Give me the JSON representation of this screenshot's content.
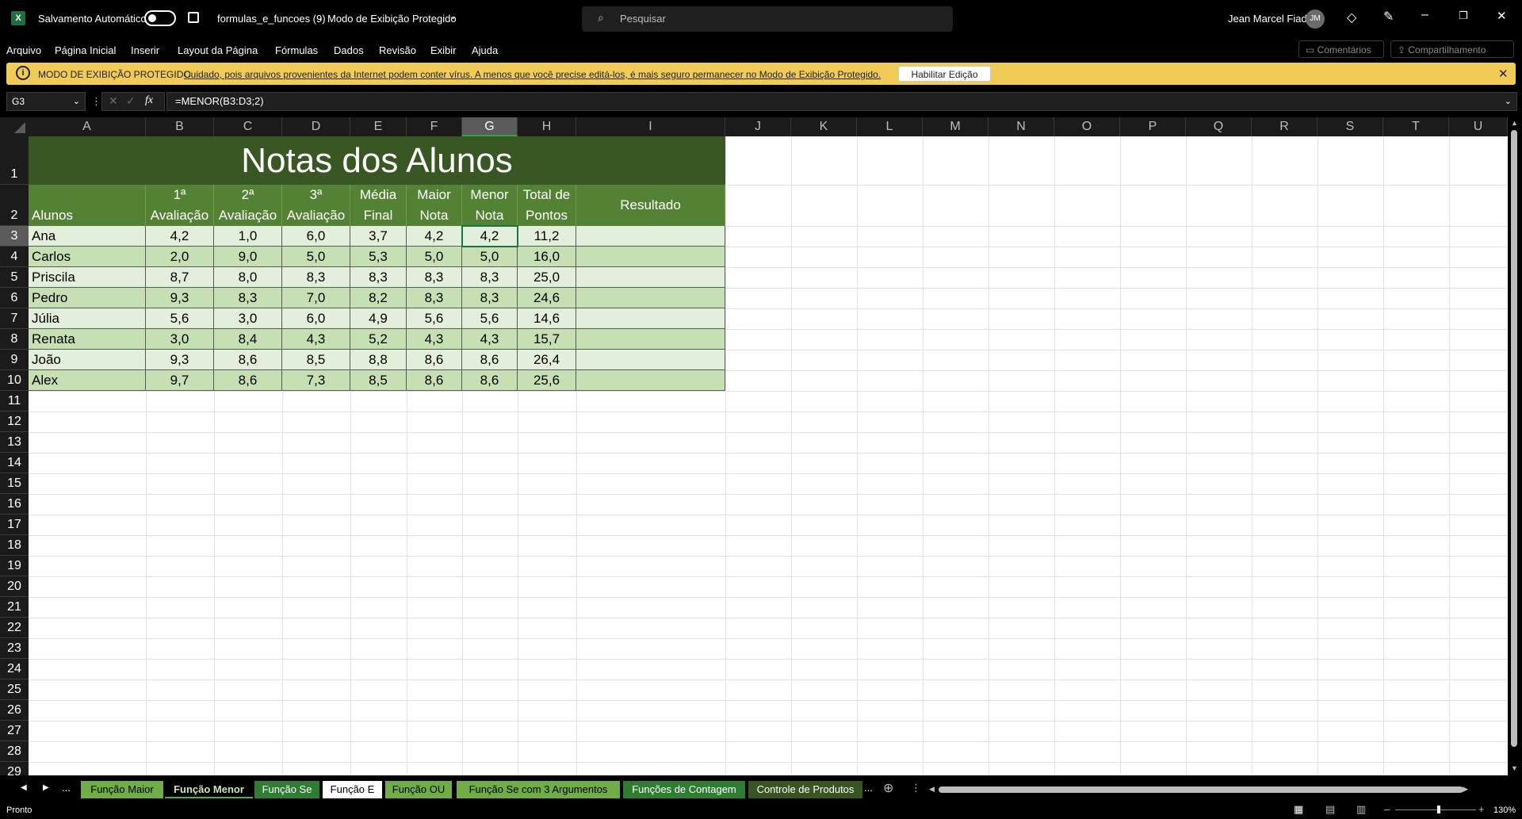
{
  "titlebar": {
    "autosave_label": "Salvamento Automático",
    "filename": "formulas_e_funcoes (9)",
    "separator": "-",
    "mode": "Modo de Exibição Protegido",
    "search_placeholder": "Pesquisar",
    "user_name": "Jean Marcel Fiad",
    "user_initials": "JM"
  },
  "menu": {
    "items": [
      "Arquivo",
      "Página Inicial",
      "Inserir",
      "Layout da Página",
      "Fórmulas",
      "Dados",
      "Revisão",
      "Exibir",
      "Ajuda"
    ],
    "comments": "Comentários",
    "share": "Compartilhamento"
  },
  "banner": {
    "title": "MODO DE EXIBIÇÃO PROTEGIDO",
    "message": "Cuidado, pois arquivos provenientes da Internet podem conter vírus. A menos que você precise editá-los, é mais seguro permanecer no Modo de  Exibição Protegido.",
    "button": "Habilitar Edição",
    "close": "✕"
  },
  "formula": {
    "cell_ref": "G3",
    "fx": "fx",
    "content": "=MENOR(B3:D3;2)"
  },
  "columns": [
    "A",
    "B",
    "C",
    "D",
    "E",
    "F",
    "G",
    "H",
    "I",
    "J",
    "K",
    "L",
    "M",
    "N",
    "O",
    "P",
    "Q",
    "R",
    "S",
    "T",
    "U"
  ],
  "selected_column": "G",
  "rows": [
    "1",
    "2",
    "3",
    "4",
    "5",
    "6",
    "7",
    "8",
    "9",
    "10",
    "11",
    "12",
    "13",
    "14",
    "15",
    "16",
    "17",
    "18",
    "19",
    "20",
    "21",
    "22",
    "23",
    "24",
    "25",
    "26",
    "27",
    "28",
    "29"
  ],
  "selected_row": "3",
  "sheet": {
    "title": "Notas dos Alunos",
    "headers": {
      "alunos": "Alunos",
      "b": [
        "1ª",
        "Avaliação"
      ],
      "c": [
        "2ª",
        "Avaliação"
      ],
      "d": [
        "3ª",
        "Avaliação"
      ],
      "e": [
        "Média",
        "Final"
      ],
      "f": [
        "Maior",
        "Nota"
      ],
      "g": [
        "Menor",
        "Nota"
      ],
      "h": [
        "Total de",
        "Pontos"
      ],
      "i": "Resultado"
    },
    "data": [
      [
        "Ana",
        "4,2",
        "1,0",
        "6,0",
        "3,7",
        "4,2",
        "4,2",
        "11,2",
        ""
      ],
      [
        "Carlos",
        "2,0",
        "9,0",
        "5,0",
        "5,3",
        "5,0",
        "5,0",
        "16,0",
        ""
      ],
      [
        "Priscila",
        "8,7",
        "8,0",
        "8,3",
        "8,3",
        "8,3",
        "8,3",
        "25,0",
        ""
      ],
      [
        "Pedro",
        "9,3",
        "8,3",
        "7,0",
        "8,2",
        "8,3",
        "8,3",
        "24,6",
        ""
      ],
      [
        "Júlia",
        "5,6",
        "3,0",
        "6,0",
        "4,9",
        "5,6",
        "5,6",
        "14,6",
        ""
      ],
      [
        "Renata",
        "3,0",
        "8,4",
        "4,3",
        "5,2",
        "4,3",
        "4,3",
        "15,7",
        ""
      ],
      [
        "João",
        "9,3",
        "8,6",
        "8,5",
        "8,8",
        "8,6",
        "8,6",
        "26,4",
        ""
      ],
      [
        "Alex",
        "9,7",
        "8,6",
        "7,3",
        "8,5",
        "8,6",
        "8,6",
        "25,6",
        ""
      ]
    ]
  },
  "tabs": {
    "ellipsis": "...",
    "items": [
      "Função Maior",
      "Função Menor",
      "Função Se",
      "Função E",
      "Função OU",
      "Função Se com 3 Argumentos",
      "Funções de Contagem",
      "Controle de Produtos"
    ],
    "active": "Função Menor"
  },
  "status": {
    "text": "Pronto",
    "zoom": "130%"
  },
  "colors": {
    "title_bg": "#385723",
    "header_bg": "#548235",
    "row_light": "#e2efda",
    "row_dark": "#c6e0b4",
    "banner": "#f1cb57"
  }
}
